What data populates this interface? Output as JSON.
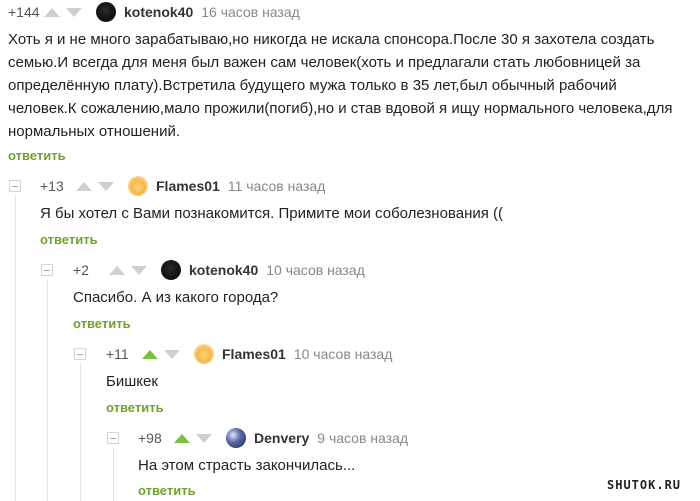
{
  "comments": [
    {
      "rating": "+144",
      "vote": "none",
      "nick": "kotenok40",
      "time": "16 часов назад",
      "text": "Хоть я и не много зарабатываю,но никогда не искала спонсора.После 30 я захотела создать\nсемью.И всегда для меня был важен сам человек(хоть и предлагали стать любовницей за\nопределённую плату).Встретила будущего мужа только в 35 лет,был обычный рабочий\nчеловек.К сожалению,мало прожили(погиб),но и став вдовой я ищу нормального человека,для\nнормальных отношений.",
      "reply": "ответить"
    },
    {
      "rating": "+13",
      "vote": "none",
      "nick": "Flames01",
      "time": "11 часов назад",
      "text": "Я бы хотел с Вами познакомится. Примите мои соболезнования ((",
      "reply": "ответить"
    },
    {
      "rating": "+2",
      "vote": "none",
      "nick": "kotenok40",
      "time": "10 часов назад",
      "text": "Спасибо. А из какого города?",
      "reply": "ответить"
    },
    {
      "rating": "+11",
      "vote": "up",
      "nick": "Flames01",
      "time": "10 часов назад",
      "text": "Бишкек",
      "reply": "ответить"
    },
    {
      "rating": "+98",
      "vote": "up",
      "nick": "Denvery",
      "time": "9 часов назад",
      "text": "На этом страсть закончилась...",
      "reply": "ответить"
    }
  ],
  "watermark": "SHUTOK.RU",
  "colors": {
    "accent_green": "#7fbf3f",
    "reply_green": "#6ea330"
  }
}
